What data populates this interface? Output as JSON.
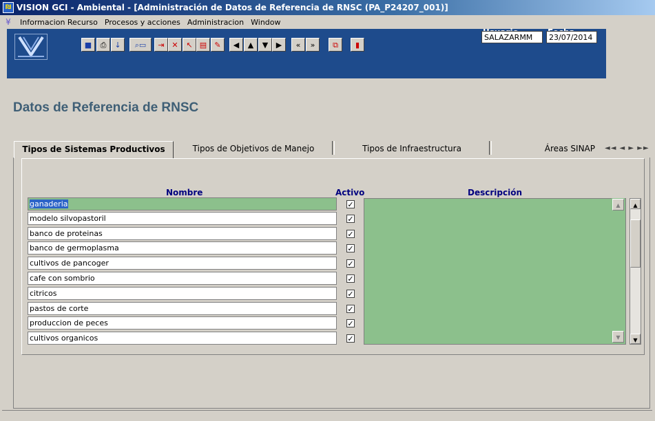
{
  "window": {
    "title": "VISION GCI - Ambiental - [Administración de Datos de Referencia de RNSC  (PA_P24207_001)]"
  },
  "menu": {
    "items": [
      "Informacion Recurso",
      "Procesos y acciones",
      "Administracion",
      "Window"
    ]
  },
  "toolbar": {
    "usuario_label": "Usuario",
    "usuario_value": "SALAZARMM",
    "fecha_label": "Fecha",
    "fecha_value": "23/07/2014"
  },
  "page": {
    "heading": "Datos de Referencia de RNSC"
  },
  "tabs": [
    {
      "label": "Tipos de Sistemas Productivos",
      "active": true
    },
    {
      "label": "Tipos de Objetivos de Manejo",
      "active": false
    },
    {
      "label": "Tipos de Infraestructura",
      "active": false
    },
    {
      "label": "Áreas SINAP",
      "active": false
    }
  ],
  "table": {
    "headers": {
      "nombre": "Nombre",
      "activo": "Activo",
      "descripcion": "Descripción"
    },
    "rows": [
      {
        "nombre": "ganaderia",
        "activo": true,
        "selected": true
      },
      {
        "nombre": "modelo silvopastoril",
        "activo": true
      },
      {
        "nombre": "banco de proteinas",
        "activo": true
      },
      {
        "nombre": "banco de germoplasma",
        "activo": true
      },
      {
        "nombre": "cultivos de pancoger",
        "activo": true
      },
      {
        "nombre": "cafe con sombrio",
        "activo": true
      },
      {
        "nombre": "citricos",
        "activo": true
      },
      {
        "nombre": "pastos de corte",
        "activo": true
      },
      {
        "nombre": "produccion de peces",
        "activo": true
      },
      {
        "nombre": "cultivos organicos",
        "activo": true
      }
    ],
    "descripcion_value": ""
  },
  "colors": {
    "title_blue": "#0a246a",
    "toolbar_blue": "#1e4b8c",
    "heading": "#3f5f76",
    "column_header": "#00007f",
    "selected_row": "#8cc08c",
    "selection_highlight": "#2b63c7"
  },
  "icons": {
    "tab_nav": "◄◄ ◄ ► ►►"
  }
}
